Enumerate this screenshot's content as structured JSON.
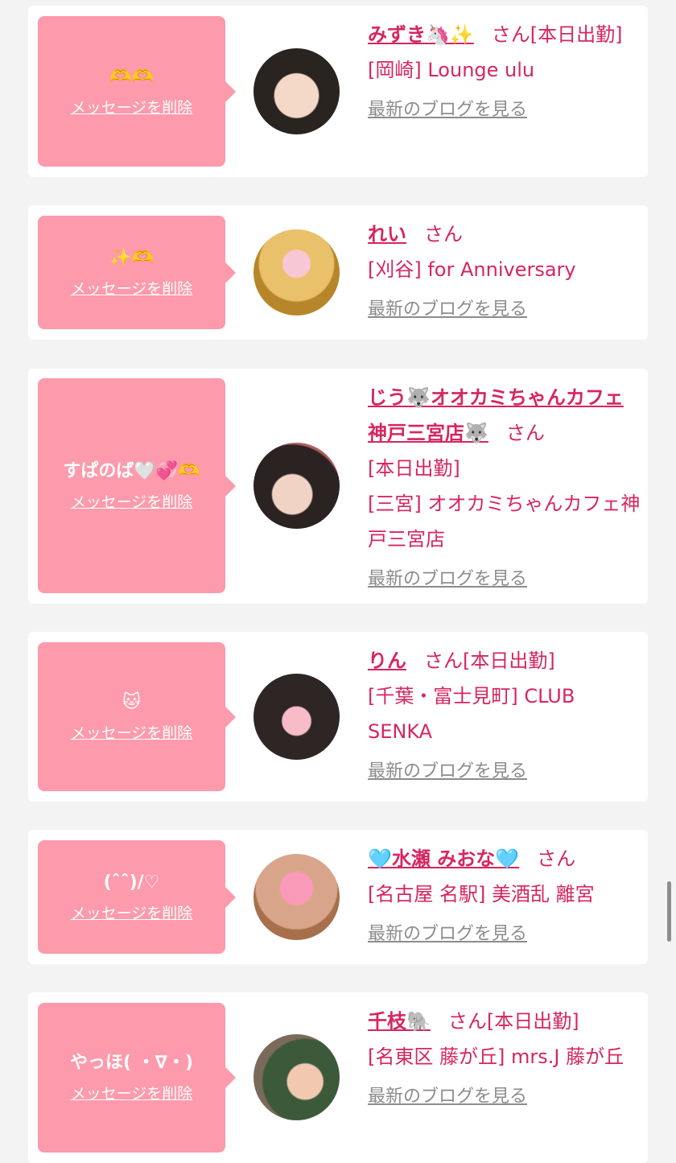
{
  "delete_label": "メッセージを削除",
  "blog_label": "最新のブログを見る",
  "san_label": "さん",
  "colors": {
    "accent": "#d6265f",
    "bubble": "#fd9aab",
    "muted": "#8c8c8c"
  },
  "items": [
    {
      "message": "🫶🫶",
      "name": "みずき🦄✨",
      "status": "[本日出勤]",
      "shop": "[岡崎] Lounge ulu"
    },
    {
      "message": "✨🫶",
      "name": "れい",
      "status": "",
      "shop": "[刈谷] for Anniversary"
    },
    {
      "message": "すぱのば🤍💞🫶",
      "name": "じう🐺オオカミちゃんカフェ神戸三宮店🐺",
      "status": "[本日出勤]",
      "shop": "[三宮] オオカミちゃんカフェ神戸三宮店"
    },
    {
      "message": "🐱",
      "name": "りん",
      "status": "[本日出勤]",
      "shop": "[千葉・富士見町] CLUB SENKA"
    },
    {
      "message": "(ˆˆ)/♡",
      "name": "🩵水瀬 みおな🩵",
      "status": "",
      "shop": "[名古屋 名駅] 美酒乱 離宮"
    },
    {
      "message": "やっほ( ・∇・)",
      "name": "千枝🐘",
      "status": "[本日出勤]",
      "shop": "[名東区 藤が丘] mrs.J 藤が丘"
    }
  ]
}
